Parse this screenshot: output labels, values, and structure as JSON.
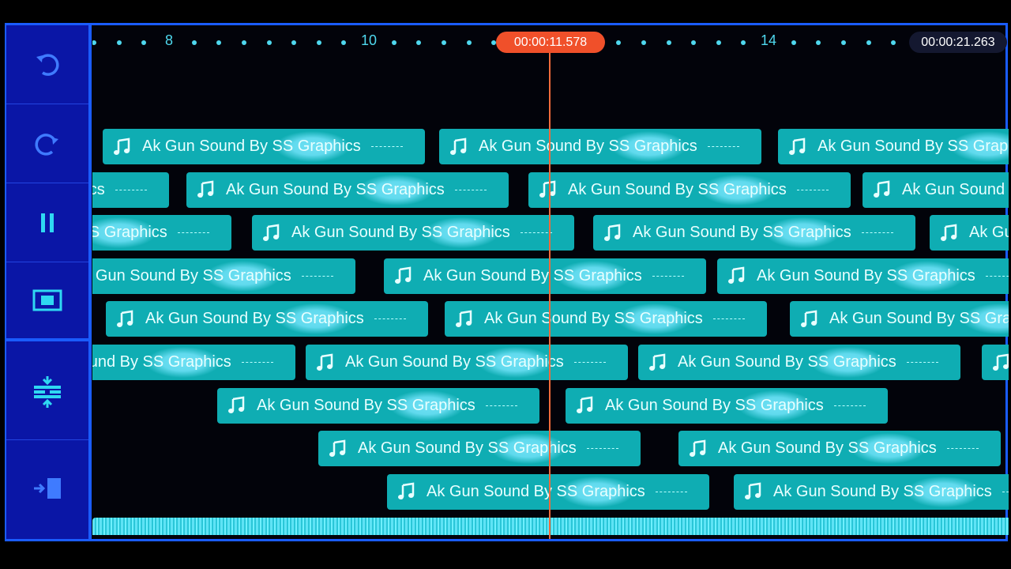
{
  "sidebar": {
    "buttons": [
      {
        "name": "undo",
        "icon": "undo-icon"
      },
      {
        "name": "redo",
        "icon": "redo-icon"
      },
      {
        "name": "pause",
        "icon": "pause-icon"
      },
      {
        "name": "preview",
        "icon": "screen-icon"
      },
      {
        "name": "compress-tracks",
        "icon": "compress-icon"
      },
      {
        "name": "exit-timeline",
        "icon": "exit-icon"
      }
    ]
  },
  "ruler": {
    "labels": [
      {
        "value": 8,
        "text": "8"
      },
      {
        "value": 10,
        "text": "10"
      },
      {
        "value": 14,
        "text": "14"
      }
    ],
    "current_time": "00:00:11.578",
    "total_time": "00:00:21.263"
  },
  "clip_label": "Ak Gun Sound By SS Graphics",
  "colors": {
    "clip": "#0fadb3",
    "playhead": "#f0502a",
    "sidebar": "#0a16a6",
    "accent": "#1a5cff"
  }
}
